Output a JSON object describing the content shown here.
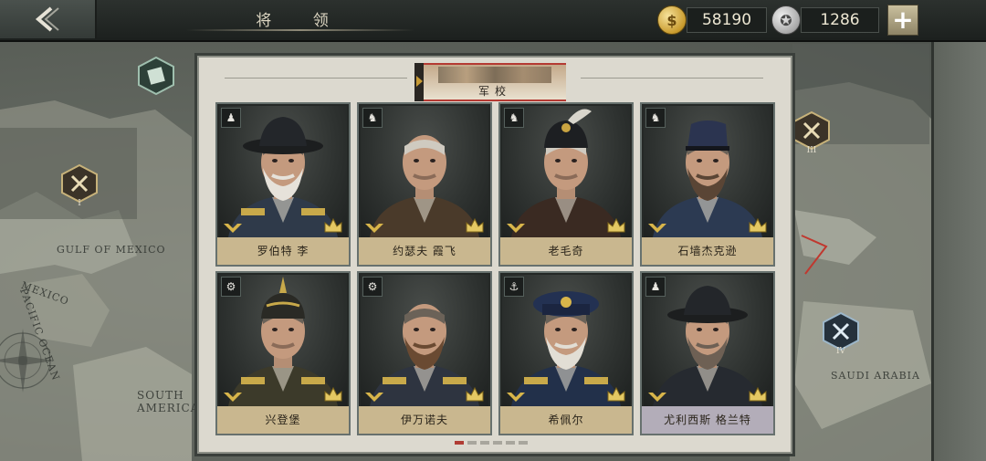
{
  "header": {
    "title": "将 领",
    "gold_value": "58190",
    "silver_value": "1286",
    "back_label": "back",
    "plus_label": "+"
  },
  "map": {
    "labels": [
      "GULF OF MEXICO",
      "MEXICO",
      "PACIFIC OCEAN",
      "SOUTH AMERICA",
      "SAUDI ARABIA"
    ],
    "markers": [
      "I",
      "III",
      "IV"
    ]
  },
  "panel": {
    "tab_label": "军校",
    "page_count": 6,
    "active_page": 1
  },
  "generals": [
    {
      "name": "罗伯特 李",
      "branch": "infantry-icon",
      "branch_glyph": "♟"
    },
    {
      "name": "约瑟夫 霞飞",
      "branch": "cavalry-icon",
      "branch_glyph": "♞"
    },
    {
      "name": "老毛奇",
      "branch": "cavalry-icon",
      "branch_glyph": "♞"
    },
    {
      "name": "石墙杰克逊",
      "branch": "cavalry-icon",
      "branch_glyph": "♞"
    },
    {
      "name": "兴登堡",
      "branch": "artillery-icon",
      "branch_glyph": "⚙"
    },
    {
      "name": "伊万诺夫",
      "branch": "artillery-icon",
      "branch_glyph": "⚙"
    },
    {
      "name": "希佩尔",
      "branch": "navy-icon",
      "branch_glyph": "⚓"
    },
    {
      "name": "尤利西斯 格兰特",
      "branch": "infantry-icon",
      "branch_glyph": "♟"
    }
  ],
  "colors": {
    "accent_red": "#b43a33",
    "name_plate": "#c9b78f",
    "name_plate_selected": "#b3adb9"
  }
}
